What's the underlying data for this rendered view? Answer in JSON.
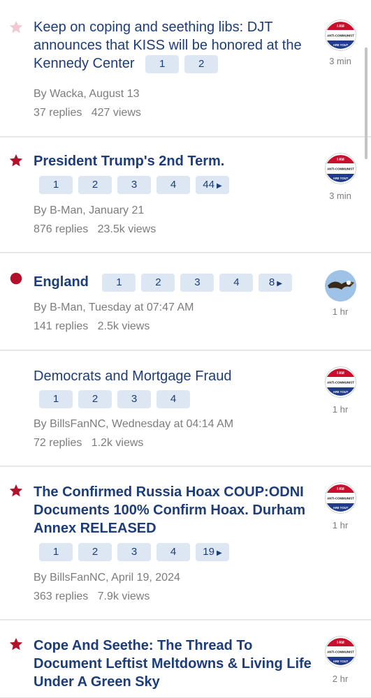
{
  "threads": [
    {
      "title": "Keep on coping and seething libs: DJT announces that KISS will be honored at the Kennedy Center",
      "pages": [
        "1",
        "2"
      ],
      "author_date": "By Wacka, August 13",
      "replies": "37 replies",
      "views": "427 views",
      "time": "3 min",
      "marker": "star-outline",
      "avatar": "anti-communist-badge"
    },
    {
      "title": "President Trump's 2nd Term.",
      "pages": [
        "1",
        "2",
        "3",
        "4",
        "44"
      ],
      "author_date": "By B-Man, January 21",
      "replies": "876 replies",
      "views": "23.5k views",
      "time": "3 min",
      "marker": "star",
      "avatar": "anti-communist-badge"
    },
    {
      "title": "England",
      "pages": [
        "1",
        "2",
        "3",
        "4",
        "8"
      ],
      "author_date": "By B-Man, Tuesday at 07:47 AM",
      "replies": "141 replies",
      "views": "2.5k views",
      "time": "1 hr",
      "marker": "dot",
      "avatar": "eagle-photo"
    },
    {
      "title": "Democrats and Mortgage Fraud",
      "pages": [
        "1",
        "2",
        "3",
        "4"
      ],
      "author_date": "By BillsFanNC, Wednesday at 04:14 AM",
      "replies": "72 replies",
      "views": "1.2k views",
      "time": "1 hr",
      "marker": "none",
      "avatar": "anti-communist-badge"
    },
    {
      "title": "The Confirmed Russia Hoax COUP:ODNI Documents 100% Confirm Hoax. Durham Annex RELEASED",
      "pages": [
        "1",
        "2",
        "3",
        "4",
        "19"
      ],
      "author_date": "By BillsFanNC, April 19, 2024",
      "replies": "363 replies",
      "views": "7.9k views",
      "time": "1 hr",
      "marker": "star",
      "avatar": "anti-communist-badge"
    },
    {
      "title": "Cope And Seethe: The Thread To Document Leftist Meltdowns & Living Life Under A Green Sky",
      "pages": [],
      "author_date": "",
      "replies": "",
      "views": "",
      "time": "2 hr",
      "marker": "star",
      "avatar": "anti-communist-badge"
    }
  ],
  "badge": {
    "line1": "I AM",
    "line2": "ANTI-COMMUNIST",
    "line3": "ARE YOU?"
  },
  "colors": {
    "accent": "#1c3d7a",
    "star": "#b3112b",
    "star_outline": "#f2c9d3",
    "page_bg": "#dde6f3",
    "meta": "#7c7c7c"
  }
}
